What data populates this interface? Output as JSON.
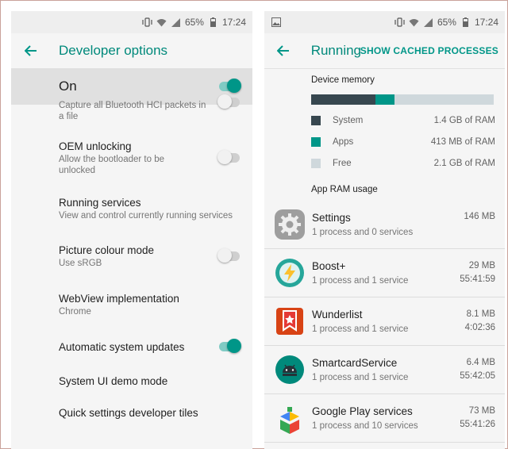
{
  "left": {
    "status": {
      "battery": "65%",
      "time": "17:24"
    },
    "title": "Developer options",
    "master_label": "On",
    "items": [
      {
        "title": "",
        "sub": "Capture all Bluetooth HCI packets in a file",
        "toggle": "off"
      },
      {
        "title": "OEM unlocking",
        "sub": "Allow the bootloader to be unlocked",
        "toggle": "off"
      },
      {
        "title": "Running services",
        "sub": "View and control currently running services",
        "toggle": "none"
      },
      {
        "title": "Picture colour mode",
        "sub": "Use sRGB",
        "toggle": "off"
      },
      {
        "title": "WebView implementation",
        "sub": "Chrome",
        "toggle": "none"
      },
      {
        "title": "Automatic system updates",
        "sub": "",
        "toggle": "on"
      },
      {
        "title": "System UI demo mode",
        "sub": "",
        "toggle": "none"
      },
      {
        "title": "Quick settings developer tiles",
        "sub": "",
        "toggle": "none"
      }
    ]
  },
  "right": {
    "status": {
      "battery": "65%",
      "time": "17:24"
    },
    "title": "Running services",
    "show_cached": "SHOW CACHED PROCESSES",
    "device_memory_heading": "Device memory",
    "memory_bar": [
      {
        "name": "System",
        "fraction": 0.35,
        "color": "#37474f"
      },
      {
        "name": "Apps",
        "fraction": 0.105,
        "color": "#009688"
      },
      {
        "name": "Free",
        "fraction": 0.545,
        "color": "#cfd8dc"
      }
    ],
    "legend": [
      {
        "name": "System",
        "value": "1.4 GB of RAM",
        "color": "#37474f"
      },
      {
        "name": "Apps",
        "value": "413 MB of RAM",
        "color": "#009688"
      },
      {
        "name": "Free",
        "value": "2.1 GB of RAM",
        "color": "#cfd8dc"
      }
    ],
    "app_ram_heading": "App RAM usage",
    "apps": [
      {
        "name": "Settings",
        "sub": "1 process and 0 services",
        "size": "146 MB",
        "time": "",
        "icon": "settings-icon"
      },
      {
        "name": "Boost+",
        "sub": "1 process and 1 service",
        "size": "29 MB",
        "time": "55:41:59",
        "icon": "boost-icon"
      },
      {
        "name": "Wunderlist",
        "sub": "1 process and 1 service",
        "size": "8.1 MB",
        "time": "4:02:36",
        "icon": "wunderlist-icon"
      },
      {
        "name": "SmartcardService",
        "sub": "1 process and 1 service",
        "size": "6.4 MB",
        "time": "55:42:05",
        "icon": "android-icon"
      },
      {
        "name": "Google Play services",
        "sub": "1 process and 10 services",
        "size": "73 MB",
        "time": "55:41:26",
        "icon": "play-services-icon"
      }
    ]
  }
}
